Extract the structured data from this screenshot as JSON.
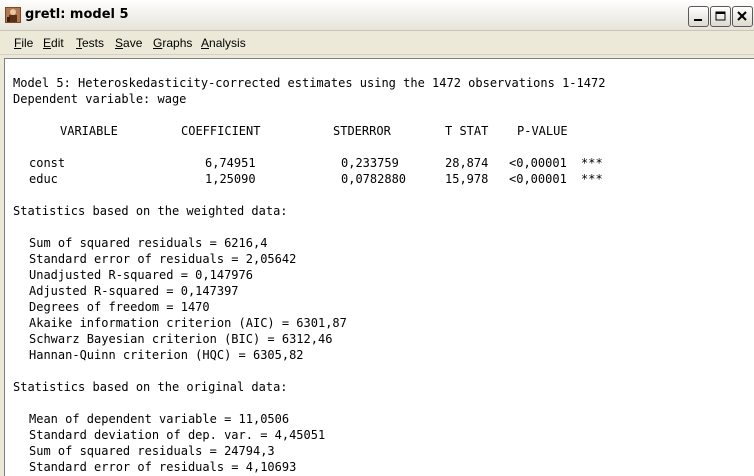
{
  "window": {
    "title": "gretl: model 5"
  },
  "menu": {
    "file": {
      "accel": "F",
      "rest": "ile"
    },
    "edit": {
      "accel": "E",
      "rest": "dit"
    },
    "tests": {
      "accel": "T",
      "rest": "ests"
    },
    "save": {
      "accel": "S",
      "rest": "ave"
    },
    "graphs": {
      "accel": "G",
      "rest": "raphs"
    },
    "analysis": {
      "accel": "A",
      "rest": "nalysis"
    }
  },
  "model": {
    "heading": "Model 5: Heteroskedasticity-corrected estimates using the 1472 observations 1-1472",
    "dependent": "Dependent variable: wage",
    "columns": {
      "variable": "VARIABLE",
      "coefficient": "COEFFICIENT",
      "stderror": "STDERROR",
      "tstat": "T STAT",
      "pvalue": "P-VALUE"
    },
    "rows": [
      {
        "variable": "const",
        "coefficient": "6,74951",
        "stderror": "0,233759",
        "tstat": "28,874",
        "pvalue": "<0,00001",
        "stars": "***"
      },
      {
        "variable": "educ",
        "coefficient": "1,25090",
        "stderror": "0,0782880",
        "tstat": "15,978",
        "pvalue": "<0,00001",
        "stars": "***"
      }
    ],
    "weighted_header": "Statistics based on the weighted data:",
    "weighted": [
      "Sum of squared residuals = 6216,4",
      "Standard error of residuals = 2,05642",
      "Unadjusted R-squared = 0,147976",
      "Adjusted R-squared = 0,147397",
      "Degrees of freedom = 1470",
      "Akaike information criterion (AIC) = 6301,87",
      "Schwarz Bayesian criterion (BIC) = 6312,46",
      "Hannan-Quinn criterion (HQC) = 6305,82"
    ],
    "original_header": "Statistics based on the original data:",
    "original": [
      "Mean of dependent variable = 11,0506",
      "Standard deviation of dep. var. = 4,45051",
      "Sum of squared residuals = 24794,3",
      "Standard error of residuals = 4,10693"
    ]
  }
}
